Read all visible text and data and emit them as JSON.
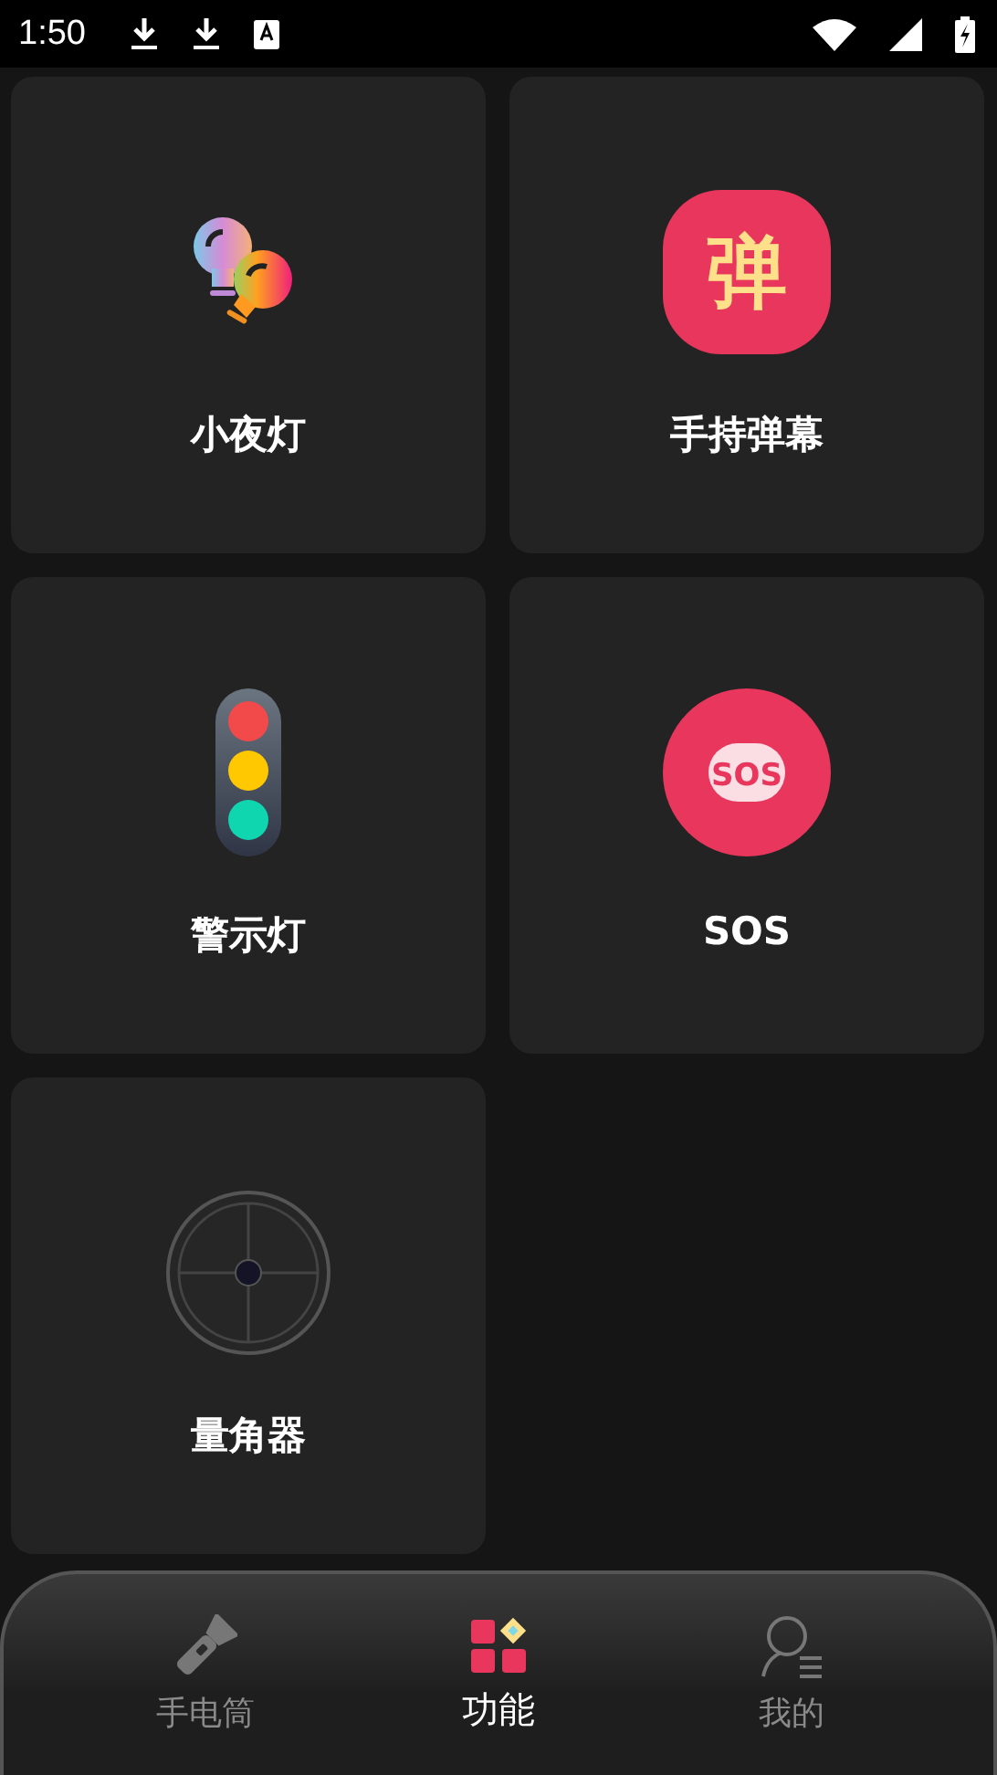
{
  "status_bar": {
    "time": "1:50"
  },
  "tools": [
    {
      "kind": "bulbs",
      "label": "小夜灯"
    },
    {
      "kind": "danmaku",
      "label": "手持弹幕",
      "icon_text": "弹"
    },
    {
      "kind": "traffic",
      "label": "警示灯"
    },
    {
      "kind": "sos",
      "label": "SOS",
      "icon_text": "SOS"
    },
    {
      "kind": "protractor",
      "label": "量角器"
    }
  ],
  "nav": [
    {
      "kind": "flashlight",
      "label": "手电筒",
      "selected": false
    },
    {
      "kind": "grid",
      "label": "功能",
      "selected": true
    },
    {
      "kind": "profile",
      "label": "我的",
      "selected": false
    }
  ]
}
